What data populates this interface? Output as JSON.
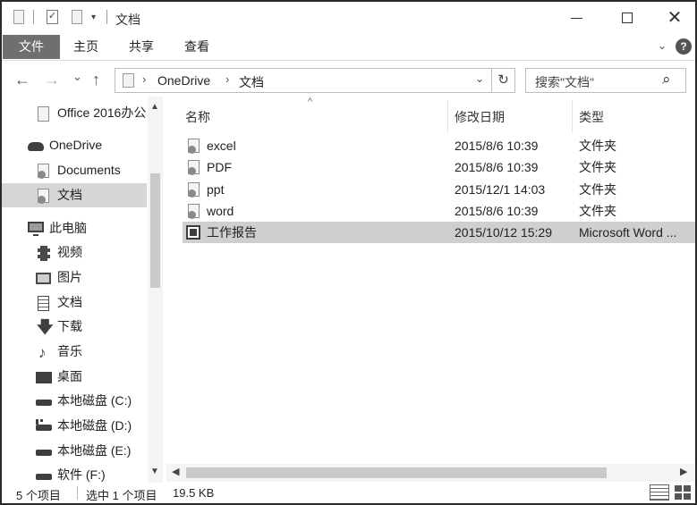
{
  "title": "文档",
  "ribbon": {
    "file": "文件",
    "tabs": [
      "主页",
      "共享",
      "查看"
    ]
  },
  "window_controls": {
    "minimize": "—",
    "maximize": "☐",
    "close": "✕"
  },
  "nav": {
    "back": "←",
    "forward": "→",
    "recent": "⌄",
    "up": "↑"
  },
  "address": {
    "crumbs": [
      "OneDrive",
      "文档"
    ],
    "separator": "›",
    "dropdown": "⌄",
    "refresh": "↻"
  },
  "search": {
    "placeholder": "搜索\"文档\"",
    "icon": "⌕"
  },
  "sidebar": {
    "items": [
      {
        "label": "Office 2016办公",
        "icon": "folder-icon"
      },
      {
        "label": "OneDrive",
        "icon": "cloud-icon"
      },
      {
        "label": "Documents",
        "icon": "sync-folder-icon"
      },
      {
        "label": "文档",
        "icon": "sync-folder-icon"
      },
      {
        "label": "此电脑",
        "icon": "computer-icon"
      },
      {
        "label": "视频",
        "icon": "video-icon"
      },
      {
        "label": "图片",
        "icon": "picture-icon"
      },
      {
        "label": "文档",
        "icon": "document-icon"
      },
      {
        "label": "下载",
        "icon": "download-icon"
      },
      {
        "label": "音乐",
        "icon": "music-icon"
      },
      {
        "label": "桌面",
        "icon": "desktop-icon"
      },
      {
        "label": "本地磁盘 (C:)",
        "icon": "drive-icon"
      },
      {
        "label": "本地磁盘 (D:)",
        "icon": "drive-icon"
      },
      {
        "label": "本地磁盘 (E:)",
        "icon": "drive-icon"
      },
      {
        "label": "软件 (F:)",
        "icon": "drive-icon"
      }
    ],
    "selected_index": 3
  },
  "files": {
    "columns": {
      "name": "名称",
      "modified": "修改日期",
      "type": "类型"
    },
    "sort_indicator": "^",
    "rows": [
      {
        "name": "excel",
        "modified": "2015/8/6 10:39",
        "type": "文件夹",
        "icon": "sync-folder-icon"
      },
      {
        "name": "PDF",
        "modified": "2015/8/6 10:39",
        "type": "文件夹",
        "icon": "sync-folder-icon"
      },
      {
        "name": "ppt",
        "modified": "2015/12/1 14:03",
        "type": "文件夹",
        "icon": "sync-folder-icon"
      },
      {
        "name": "word",
        "modified": "2015/8/6 10:39",
        "type": "文件夹",
        "icon": "sync-folder-icon"
      },
      {
        "name": "工作报告",
        "modified": "2015/10/12 15:29",
        "type": "Microsoft Word ...",
        "icon": "word-doc-icon"
      }
    ],
    "selected_index": 4
  },
  "status": {
    "count": "5 个项目",
    "selection": "选中 1 个项目",
    "size": "19.5 KB"
  }
}
